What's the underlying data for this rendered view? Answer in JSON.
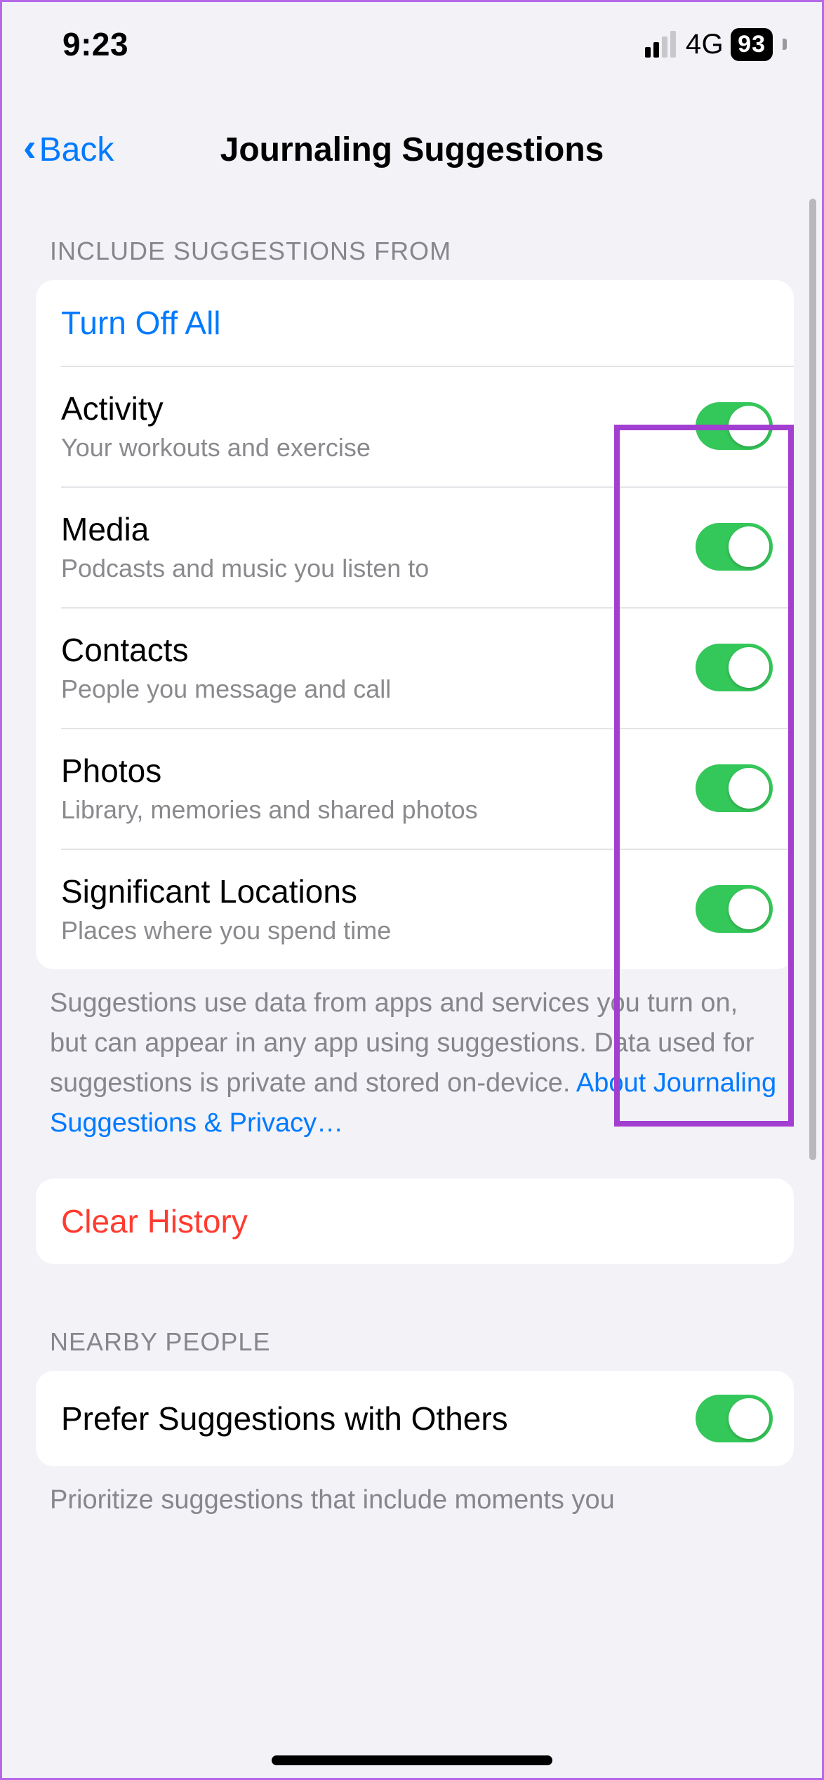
{
  "status": {
    "time": "9:23",
    "network": "4G",
    "battery": "93",
    "signal_bars_active": 2
  },
  "nav": {
    "back_label": "Back",
    "title": "Journaling Suggestions"
  },
  "sections": {
    "include": {
      "header": "INCLUDE SUGGESTIONS FROM",
      "turn_off_all": "Turn Off All",
      "items": [
        {
          "title": "Activity",
          "subtitle": "Your workouts and exercise",
          "on": true
        },
        {
          "title": "Media",
          "subtitle": "Podcasts and music you listen to",
          "on": true
        },
        {
          "title": "Contacts",
          "subtitle": "People you message and call",
          "on": true
        },
        {
          "title": "Photos",
          "subtitle": "Library, memories and shared photos",
          "on": true
        },
        {
          "title": "Significant Locations",
          "subtitle": "Places where you spend time",
          "on": true
        }
      ],
      "footer_text": "Suggestions use data from apps and services you turn on, but can appear in any app using suggestions. Data used for suggestions is private and stored on-device. ",
      "footer_link": "About Journaling Suggestions & Privacy…"
    },
    "clear_history": "Clear History",
    "nearby": {
      "header": "NEARBY PEOPLE",
      "item": {
        "title": "Prefer Suggestions with Others",
        "on": true
      },
      "footer_text": "Prioritize suggestions that include moments you"
    }
  },
  "colors": {
    "accent_blue": "#007aff",
    "accent_red": "#ff3b30",
    "toggle_green": "#34c759",
    "highlight": "#a23fd1"
  }
}
